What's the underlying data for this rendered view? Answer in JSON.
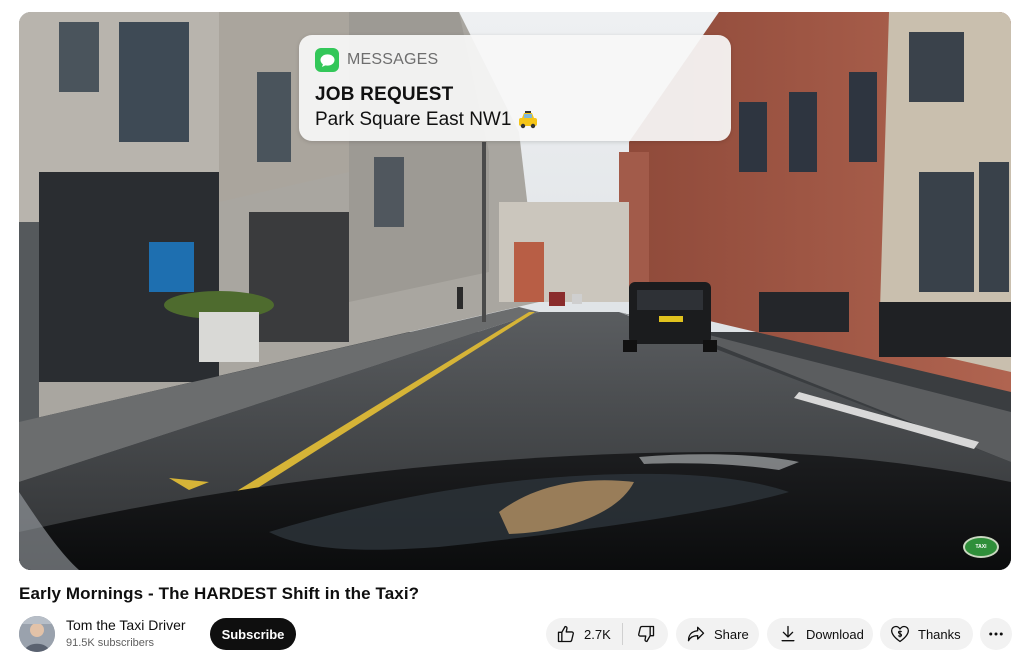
{
  "notification": {
    "app": "MESSAGES",
    "title": "JOB REQUEST",
    "body": "Park Square East NW1"
  },
  "video": {
    "title": "Early Mornings - The HARDEST Shift in the Taxi?"
  },
  "channel": {
    "name": "Tom the Taxi Driver",
    "subscribers": "91.5K subscribers",
    "subscribe_label": "Subscribe"
  },
  "actions": {
    "like_count": "2.7K",
    "share_label": "Share",
    "download_label": "Download",
    "thanks_label": "Thanks"
  },
  "icons": {
    "messages": "message-bubble-icon",
    "taxi": "taxi-icon",
    "like": "thumbs-up-icon",
    "dislike": "thumbs-down-icon",
    "share": "share-arrow-icon",
    "download": "download-icon",
    "thanks": "super-thanks-icon",
    "more": "more-horizontal-icon"
  },
  "colors": {
    "subscribe_bg": "#0f0f0f",
    "pill_bg": "#f2f2f2",
    "messages_green": "#33c759"
  }
}
